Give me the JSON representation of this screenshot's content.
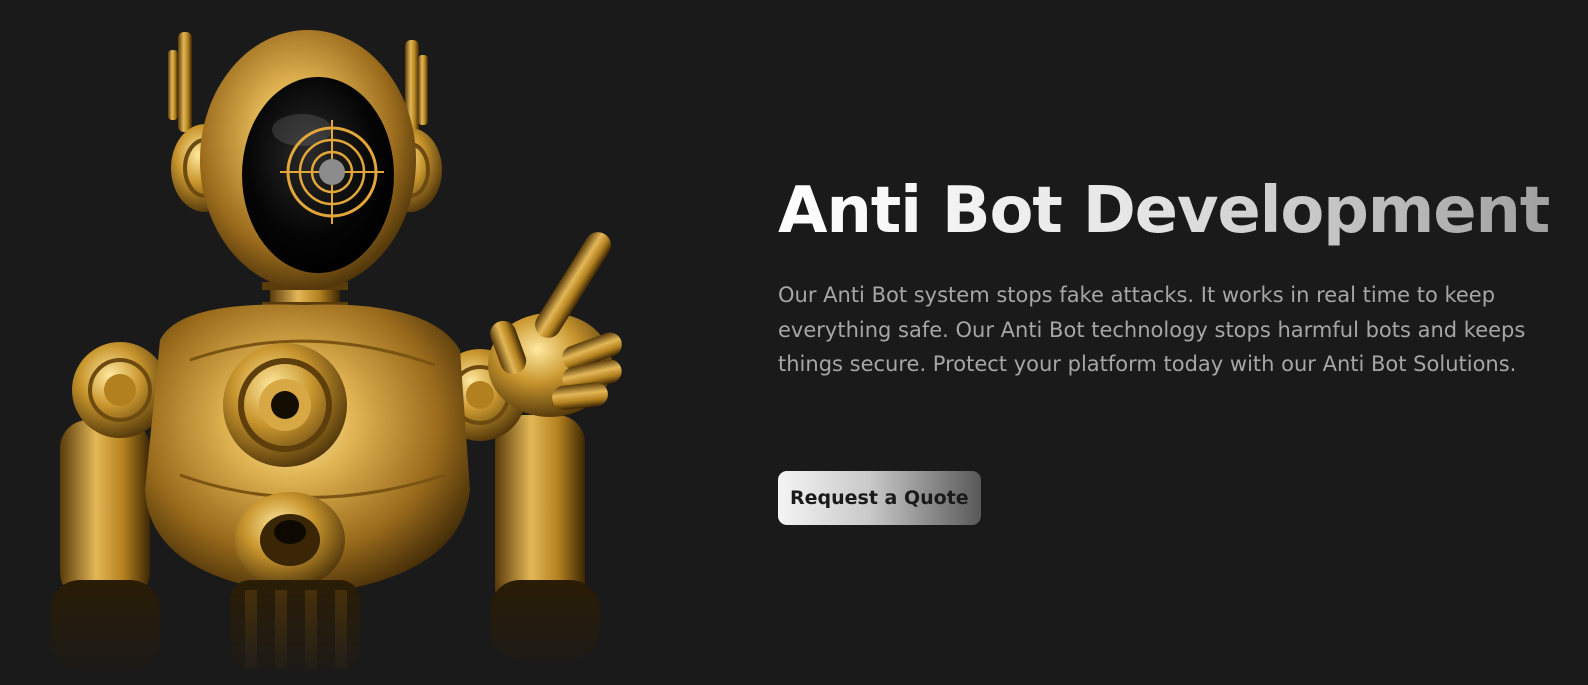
{
  "hero": {
    "title": "Anti Bot Development",
    "description": "Our Anti Bot system stops fake attacks. It works in real time to keep everything safe. Our Anti Bot technology stops harmful bots and keeps things secure. Protect your platform today with our Anti Bot Solutions.",
    "cta_label": "Request a Quote",
    "image_icon": "golden-robot-illustration",
    "colors": {
      "background": "#1a1a1a",
      "title_gradient_start": "#ffffff",
      "title_gradient_end": "#9d9d9d",
      "description_text": "#a6a6a6",
      "button_gradient_start": "#f4f4f4",
      "button_gradient_end": "#585858",
      "button_text": "#1a1a1a",
      "robot_gold": "#c9962e"
    }
  }
}
